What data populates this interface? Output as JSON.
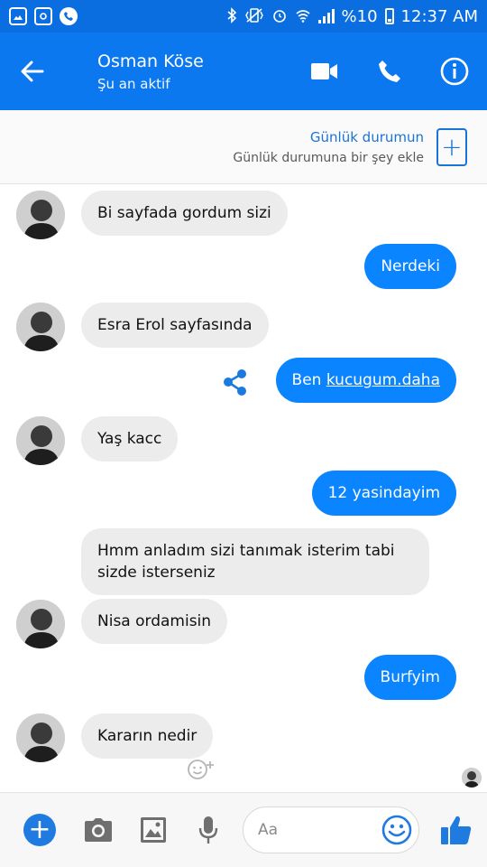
{
  "status_bar": {
    "battery_text": "%10",
    "time": "12:37 AM",
    "left_icons": [
      "gallery-icon",
      "instagram-icon",
      "phone-call-icon"
    ],
    "right_icons": [
      "bluetooth-icon",
      "vibrate-icon",
      "alarm-icon",
      "wifi-icon",
      "signal-icon",
      "battery-icon"
    ]
  },
  "header": {
    "contact_name": "Osman Köse",
    "status": "Şu an aktif",
    "colors": {
      "bar": "#0b78f0",
      "status_bar": "#0a6ee0"
    }
  },
  "story": {
    "title": "Günlük durumun",
    "subtitle": "Günlük durumuna bir şey ekle",
    "add_symbol": "+"
  },
  "messages": [
    {
      "direction": "in",
      "text": "Bi sayfada gordum sizi",
      "avatar": true
    },
    {
      "direction": "out",
      "text": "Nerdeki"
    },
    {
      "direction": "in",
      "text": "Esra Erol sayfasında",
      "avatar": true
    },
    {
      "direction": "out",
      "text_prefix": "Ben ",
      "link_text": "kucugum.daha",
      "share_icon": true
    },
    {
      "direction": "in",
      "text": "Yaş kacc",
      "avatar": true
    },
    {
      "direction": "out",
      "text": "12 yasindayim"
    },
    {
      "direction": "in",
      "text": "Hmm anladım sizi tanımak isterim tabi sizde isterseniz",
      "avatar": false
    },
    {
      "direction": "in",
      "text": "Nisa ordamisin",
      "avatar": true
    },
    {
      "direction": "out",
      "text": "Burfyim"
    },
    {
      "direction": "in",
      "text": "Kararın nedir",
      "avatar": true,
      "reaction_prompt": true
    }
  ],
  "composer": {
    "placeholder": "Aa",
    "plus_symbol": "+",
    "colors": {
      "accent": "#1f7be0",
      "outgoing_bubble": "#0a84ff",
      "incoming_bubble": "#ececec"
    }
  }
}
